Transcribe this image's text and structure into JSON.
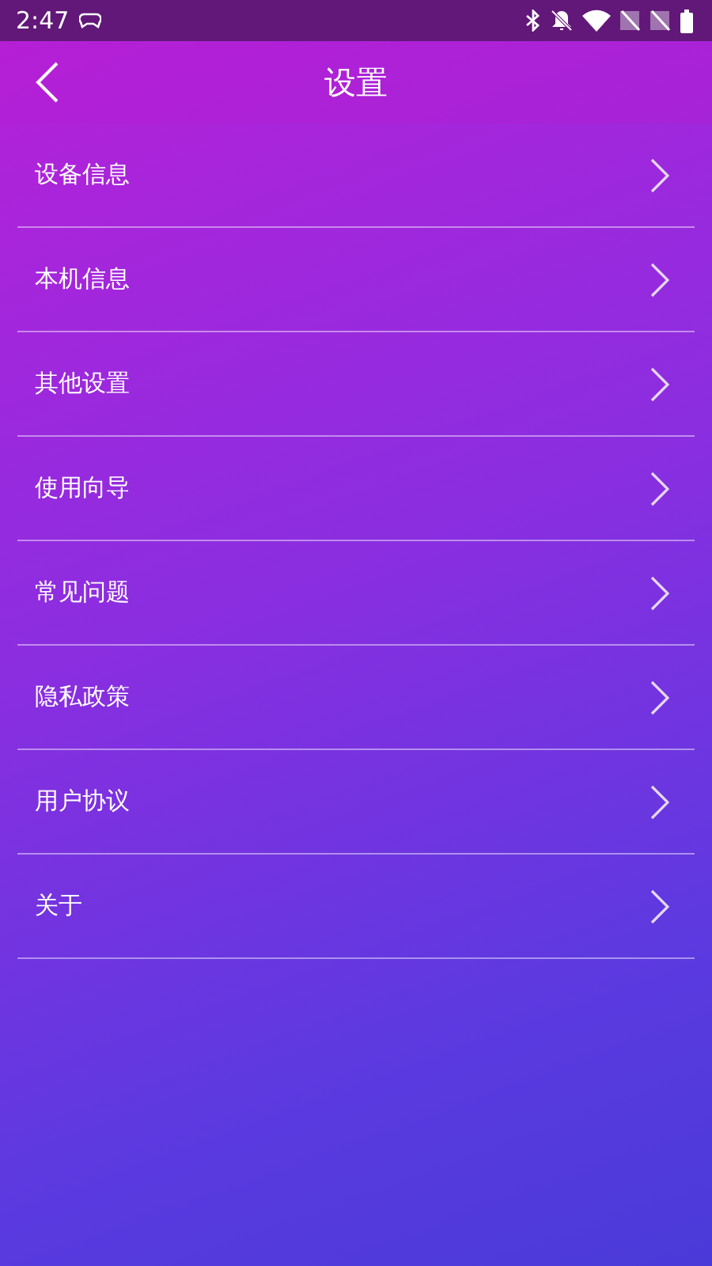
{
  "status_bar": {
    "time": "2:47"
  },
  "header": {
    "title": "设置"
  },
  "menu": [
    {
      "label": "设备信息"
    },
    {
      "label": "本机信息"
    },
    {
      "label": "其他设置"
    },
    {
      "label": "使用向导"
    },
    {
      "label": "常见问题"
    },
    {
      "label": "隐私政策"
    },
    {
      "label": "用户协议"
    },
    {
      "label": "关于"
    }
  ]
}
